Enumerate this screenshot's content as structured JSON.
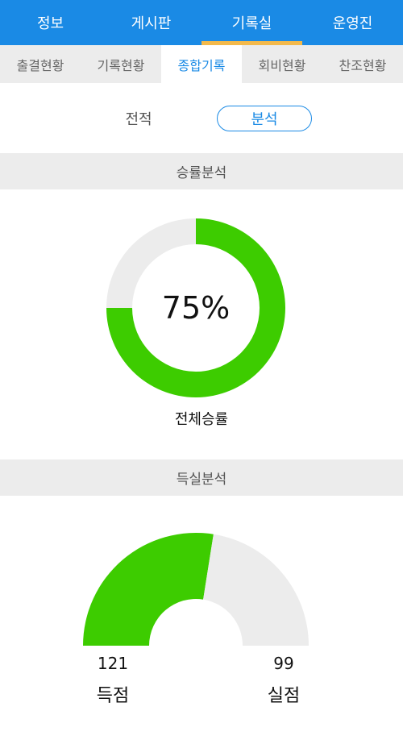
{
  "top_nav": {
    "tabs": [
      {
        "label": "정보"
      },
      {
        "label": "게시판"
      },
      {
        "label": "기록실"
      },
      {
        "label": "운영진"
      }
    ],
    "active_index": 2
  },
  "sub_nav": {
    "tabs": [
      {
        "label": "출결현황"
      },
      {
        "label": "기록현황"
      },
      {
        "label": "종합기록"
      },
      {
        "label": "회비현황"
      },
      {
        "label": "찬조현황"
      }
    ],
    "active_index": 2
  },
  "view_toggle": {
    "record_label": "전적",
    "analysis_label": "분석",
    "active": "분석"
  },
  "win_rate": {
    "section_title": "승률분석",
    "percent_text": "75%",
    "caption": "전체승률"
  },
  "score_analysis": {
    "section_title": "득실분석",
    "scored_value": "121",
    "scored_label": "득점",
    "conceded_value": "99",
    "conceded_label": "실점"
  },
  "chart_data": [
    {
      "type": "pie",
      "title": "",
      "slices": [
        {
          "label": "win",
          "value": 75,
          "color": "#3dcc00"
        },
        {
          "label": "other",
          "value": 25,
          "color": "#ececec"
        }
      ],
      "center_text": "75%",
      "caption": "전체승률"
    },
    {
      "type": "pie",
      "title": "",
      "shape": "half-donut",
      "slices": [
        {
          "label": "득점",
          "value": 121,
          "color": "#3dcc00"
        },
        {
          "label": "실점",
          "value": 99,
          "color": "#ececec"
        }
      ]
    }
  ],
  "colors": {
    "primary": "#1a8ae5",
    "accent_underline": "#f3b94b",
    "positive": "#3dcc00",
    "neutral_track": "#ececec"
  }
}
